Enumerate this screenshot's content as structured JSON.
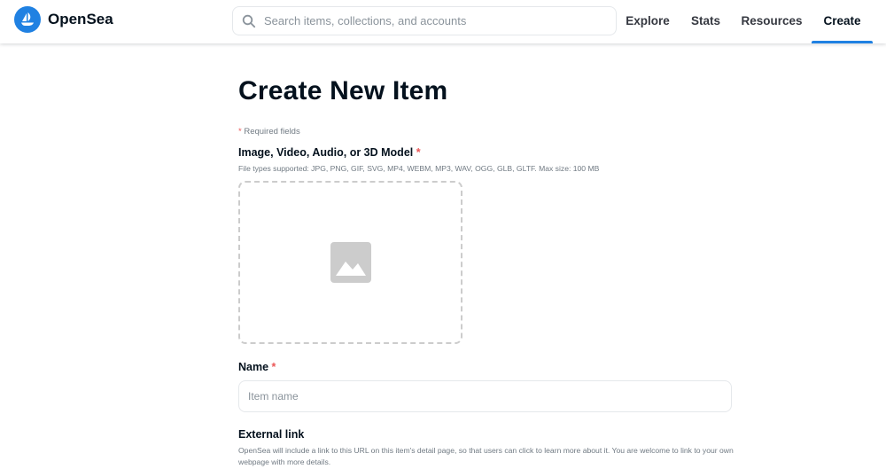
{
  "header": {
    "brand": "OpenSea",
    "search_placeholder": "Search items, collections, and accounts",
    "nav": {
      "explore": "Explore",
      "stats": "Stats",
      "resources": "Resources",
      "create": "Create"
    },
    "active_nav": "Create"
  },
  "main": {
    "title": "Create New Item",
    "required_star": "*",
    "required_note": " Required fields",
    "media": {
      "label": "Image, Video, Audio, or 3D Model",
      "star": "*",
      "hint": "File types supported: JPG, PNG, GIF, SVG, MP4, WEBM, MP3, WAV, OGG, GLB, GLTF. Max size: 100 MB",
      "icon": "image-placeholder-icon"
    },
    "name": {
      "label": "Name",
      "star": "*",
      "placeholder": "Item name",
      "value": ""
    },
    "external_link": {
      "label": "External link",
      "hint": "OpenSea will include a link to this URL on this item's detail page, so that users can click to learn more about it. You are welcome to link to your own webpage with more details."
    }
  },
  "colors": {
    "brand_blue": "#2081e2",
    "required_red": "#eb5757",
    "text_dark": "#04111d",
    "text_muted": "#707a83",
    "border": "#e5e8eb",
    "dropzone_gray": "#cccccc"
  }
}
